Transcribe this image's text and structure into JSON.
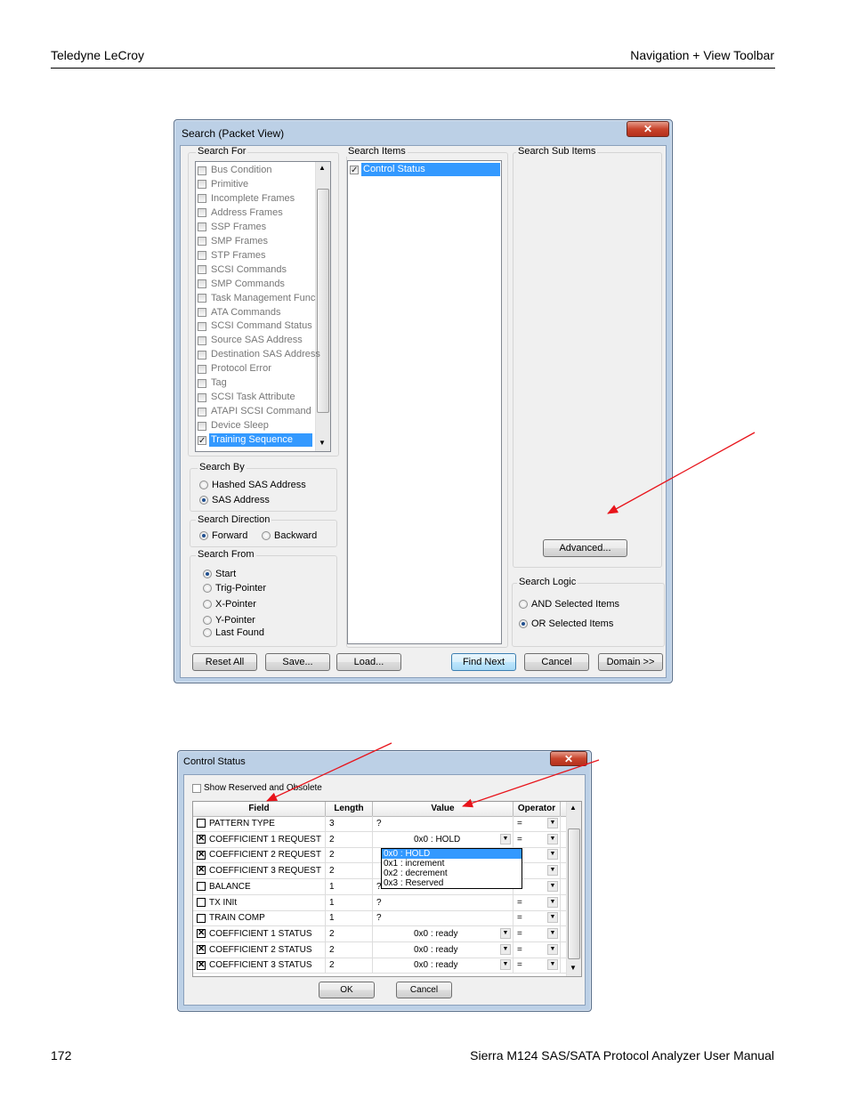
{
  "page": {
    "header_left": "Teledyne LeCroy",
    "header_right": "Navigation + View Toolbar",
    "footer_left": "172",
    "footer_right": "Sierra M124 SAS/SATA Protocol Analyzer User Manual"
  },
  "search_dialog": {
    "title": "Search (Packet View)",
    "close_glyph": "✕",
    "search_for": {
      "label": "Search For",
      "items": [
        {
          "label": "Bus Condition",
          "checked": false
        },
        {
          "label": "Primitive",
          "checked": false
        },
        {
          "label": "Incomplete Frames",
          "checked": false
        },
        {
          "label": "Address Frames",
          "checked": false
        },
        {
          "label": "SSP Frames",
          "checked": false
        },
        {
          "label": "SMP Frames",
          "checked": false
        },
        {
          "label": "STP Frames",
          "checked": false
        },
        {
          "label": "SCSI Commands",
          "checked": false
        },
        {
          "label": "SMP Commands",
          "checked": false
        },
        {
          "label": "Task Management Func",
          "checked": false
        },
        {
          "label": "ATA Commands",
          "checked": false
        },
        {
          "label": "SCSI Command Status",
          "checked": false
        },
        {
          "label": "Source SAS Address",
          "checked": false
        },
        {
          "label": "Destination SAS Address",
          "checked": false
        },
        {
          "label": "Protocol Error",
          "checked": false
        },
        {
          "label": "Tag",
          "checked": false
        },
        {
          "label": "SCSI Task Attribute",
          "checked": false
        },
        {
          "label": "ATAPI SCSI Command",
          "checked": false
        },
        {
          "label": "Device Sleep",
          "checked": false
        },
        {
          "label": "Training Sequence",
          "checked": true
        }
      ]
    },
    "search_items": {
      "label": "Search Items",
      "items": [
        {
          "label": "Control Status",
          "checked": true
        }
      ]
    },
    "search_sub_items": {
      "label": "Search Sub Items"
    },
    "advanced_button": "Advanced...",
    "search_by": {
      "label": "Search By",
      "options": [
        {
          "label": "Hashed SAS Address",
          "selected": false
        },
        {
          "label": "SAS Address",
          "selected": true
        }
      ]
    },
    "search_direction": {
      "label": "Search Direction",
      "options": [
        {
          "label": "Forward",
          "selected": true
        },
        {
          "label": "Backward",
          "selected": false
        }
      ]
    },
    "search_from": {
      "label": "Search From",
      "options": [
        {
          "label": "Start",
          "selected": true
        },
        {
          "label": "Trig-Pointer",
          "selected": false
        },
        {
          "label": "X-Pointer",
          "selected": false
        },
        {
          "label": "Y-Pointer",
          "selected": false
        },
        {
          "label": "Last Found",
          "selected": false
        }
      ]
    },
    "search_logic": {
      "label": "Search Logic",
      "options": [
        {
          "label": "AND Selected Items",
          "selected": false
        },
        {
          "label": "OR Selected Items",
          "selected": true
        }
      ]
    },
    "buttons": {
      "reset_all": "Reset All",
      "save": "Save...",
      "load": "Load...",
      "find_next": "Find Next",
      "cancel": "Cancel",
      "domain": "Domain >>"
    }
  },
  "control_dialog": {
    "title": "Control Status",
    "close_glyph": "✕",
    "show_reserved_label": "Show Reserved and Obsolete",
    "columns": {
      "field": "Field",
      "length": "Length",
      "value": "Value",
      "operator": "Operator"
    },
    "rows": [
      {
        "checked": false,
        "field": "PATTERN TYPE",
        "length": "3",
        "value": "?",
        "value_dropdown": false,
        "operator": "="
      },
      {
        "checked": true,
        "field": "COEFFICIENT 1 REQUEST",
        "length": "2",
        "value": "0x0 : HOLD",
        "value_dropdown": true,
        "operator": "="
      },
      {
        "checked": true,
        "field": "COEFFICIENT 2 REQUEST",
        "length": "2",
        "value": "",
        "value_dropdown": false,
        "operator": "="
      },
      {
        "checked": true,
        "field": "COEFFICIENT 3 REQUEST",
        "length": "2",
        "value": "",
        "value_dropdown": false,
        "operator": "="
      },
      {
        "checked": false,
        "field": "BALANCE",
        "length": "1",
        "value": "?",
        "value_dropdown": false,
        "operator": "="
      },
      {
        "checked": false,
        "field": "TX INIt",
        "length": "1",
        "value": "?",
        "value_dropdown": false,
        "operator": "="
      },
      {
        "checked": false,
        "field": "TRAIN COMP",
        "length": "1",
        "value": "?",
        "value_dropdown": false,
        "operator": "="
      },
      {
        "checked": true,
        "field": "COEFFICIENT 1 STATUS",
        "length": "2",
        "value": "0x0 : ready",
        "value_dropdown": true,
        "operator": "="
      },
      {
        "checked": true,
        "field": "COEFFICIENT 2 STATUS",
        "length": "2",
        "value": "0x0 : ready",
        "value_dropdown": true,
        "operator": "="
      },
      {
        "checked": true,
        "field": "COEFFICIENT 3 STATUS",
        "length": "2",
        "value": "0x0 : ready",
        "value_dropdown": true,
        "operator": "="
      }
    ],
    "dropdown_options": [
      "0x0 : HOLD",
      "0x1 : increment",
      "0x2 : decrement",
      "0x3 : Reserved"
    ],
    "ok_button": "OK",
    "cancel_button": "Cancel"
  },
  "colors": {
    "selection": "#3399ff",
    "annotation_arrow": "#e8141b",
    "window_frame": "#bcd0e6"
  }
}
